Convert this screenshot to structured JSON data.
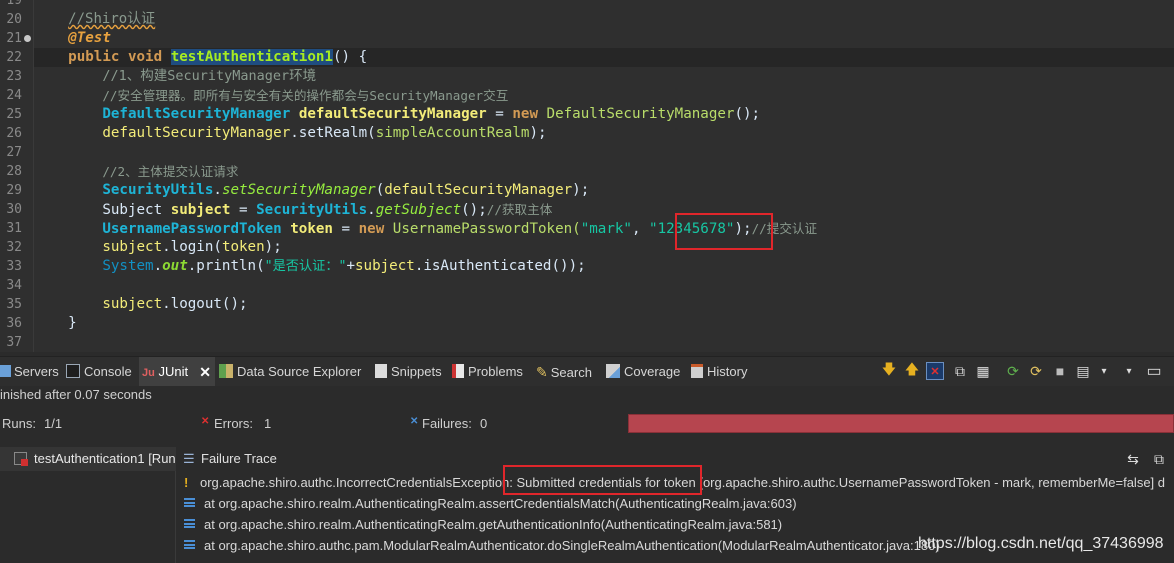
{
  "editor": {
    "line_numbers": [
      "19",
      "20",
      "21",
      "22",
      "23",
      "24",
      "25",
      "26",
      "27",
      "28",
      "29",
      "30",
      "31",
      "32",
      "33",
      "34",
      "35",
      "36",
      "37"
    ],
    "code": {
      "l20_comment": "//Shiro认证",
      "l21_annotation": "@Test",
      "l22_kw1": "public",
      "l22_kw2": "void",
      "l22_method": "testAuthentication1",
      "l22_rest": "() {",
      "l23_comment": "//1、构建SecurityManager环境",
      "l24_comment": "//安全管理器。即所有与安全有关的操作都会与SecurityManager交互",
      "l25_type": "DefaultSecurityManager",
      "l25_var": "defaultSecurityManager",
      "l25_eq": " = ",
      "l25_new": "new",
      "l25_ctor": "DefaultSecurityManager",
      "l25_end": "();",
      "l26_obj": "defaultSecurityManager",
      "l26_call": ".setRealm(",
      "l26_arg": "simpleAccountRealm",
      "l26_end": ");",
      "l28_comment": "//2、主体提交认证请求",
      "l29_cls": "SecurityUtils",
      "l29_dot": ".",
      "l29_method": "setSecurityManager",
      "l29_open": "(",
      "l29_arg": "defaultSecurityManager",
      "l29_end": ");",
      "l30_type": "Subject",
      "l30_var": "subject",
      "l30_eq": " = ",
      "l30_cls": "SecurityUtils",
      "l30_dot": ".",
      "l30_method": "getSubject",
      "l30_end": "();",
      "l30_comment": "//获取主体",
      "l31_type": "UsernamePasswordToken",
      "l31_var": "token",
      "l31_eq": " = ",
      "l31_new": "new",
      "l31_ctor": "UsernamePasswordToken(",
      "l31_str1": "\"mark\"",
      "l31_comma": ", ",
      "l31_str2": "\"12345678\"",
      "l31_end": ");",
      "l31_comment": "//提交认证",
      "l32_obj": "subject",
      "l32_call": ".login(",
      "l32_arg": "token",
      "l32_end": ");",
      "l33_cls": "System",
      "l33_dot": ".",
      "l33_field": "out",
      "l33_call": ".println(",
      "l33_str": "\"是否认证：\"",
      "l33_plus": "+",
      "l33_obj": "subject",
      "l33_meth": ".isAuthenticated",
      "l33_end": "());",
      "l35_obj": "subject",
      "l35_call": ".logout();",
      "l36_brace": "}"
    }
  },
  "tabs": [
    {
      "label": "Servers",
      "icon": "servers-icon"
    },
    {
      "label": "Console",
      "icon": "console-icon"
    },
    {
      "label": "JUnit",
      "icon": "junit-icon"
    },
    {
      "label": "Data Source Explorer",
      "icon": "data-source-icon"
    },
    {
      "label": "Snippets",
      "icon": "snippets-icon"
    },
    {
      "label": "Problems",
      "icon": "problems-icon"
    },
    {
      "label": "Search",
      "icon": "search-icon"
    },
    {
      "label": "Coverage",
      "icon": "coverage-icon"
    },
    {
      "label": "History",
      "icon": "history-icon"
    }
  ],
  "junit": {
    "finished": "inished after 0.07 seconds",
    "runs_label": "Runs:",
    "runs_value": "1/1",
    "errors_label": "Errors:",
    "errors_value": "1",
    "failures_label": "Failures:",
    "failures_value": "0",
    "test_item": "testAuthentication1 [Run",
    "failure_trace_title": "Failure Trace",
    "trace": [
      "org.apache.shiro.authc.IncorrectCredentialsException: Submitted credentials for token [org.apache.shiro.authc.UsernamePasswordToken - mark, rememberMe=false] d",
      "at org.apache.shiro.realm.AuthenticatingRealm.assertCredentialsMatch(AuthenticatingRealm.java:603)",
      "at org.apache.shiro.realm.AuthenticatingRealm.getAuthenticationInfo(AuthenticatingRealm.java:581)",
      "at org.apache.shiro.authc.pam.ModularRealmAuthenticator.doSingleRealmAuthentication(ModularRealmAuthenticator.java:180)"
    ]
  },
  "watermark": "https://blog.csdn.net/qq_37436998",
  "colors": {
    "editor_bg": "#2f2f2f",
    "keyword": "#d29a54",
    "string": "#17c6a3",
    "error_bar": "#b6454f",
    "highlight_box": "#e0262b"
  }
}
